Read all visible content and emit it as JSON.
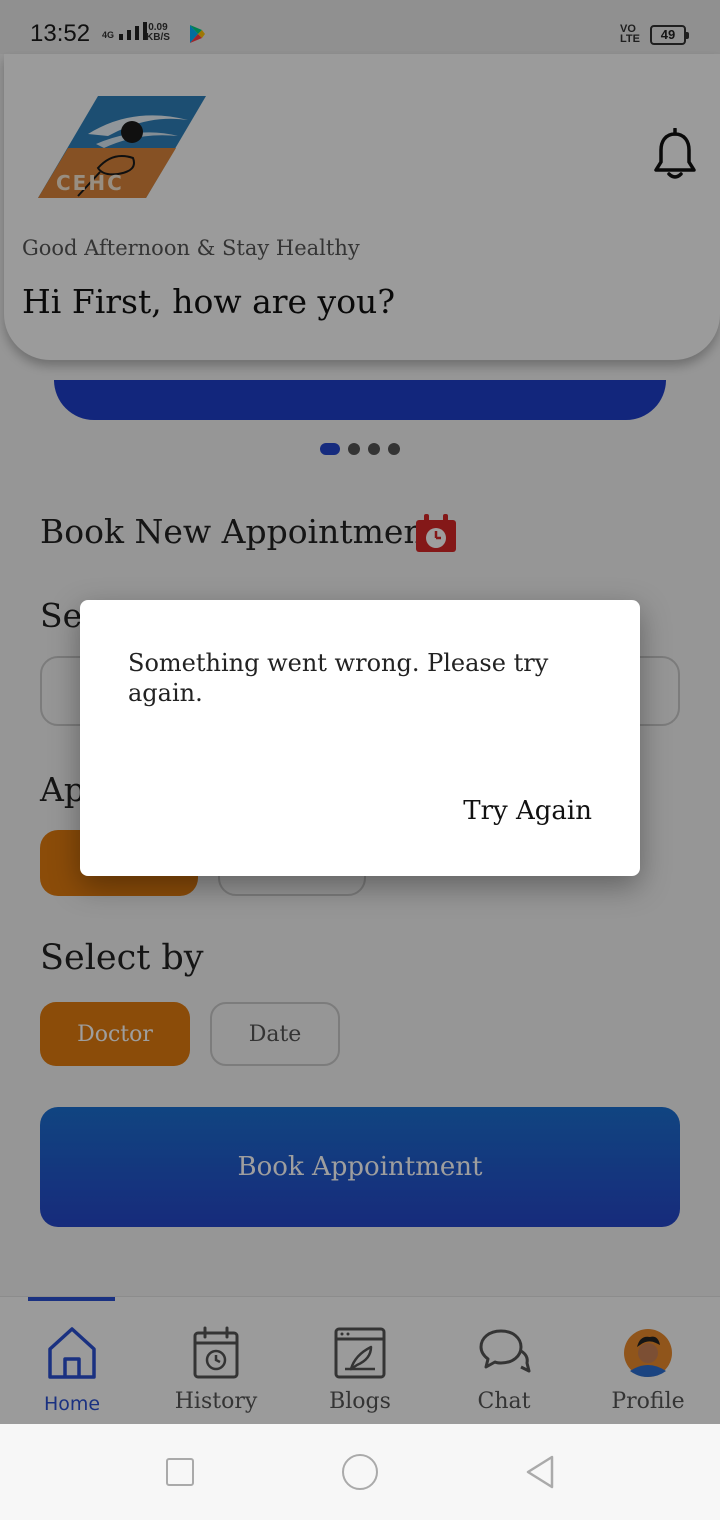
{
  "status_bar": {
    "time": "13:52",
    "network": "4G",
    "speed_value": "0.09",
    "speed_unit": "KB/S",
    "volte": "VO LTE",
    "battery": "49"
  },
  "header": {
    "logo_text": "CEHC",
    "greeting_sub": "Good Afternoon & Stay Healthy",
    "greeting_main": "Hi First, how are you?"
  },
  "carousel": {
    "pages": 4,
    "active_index": 0
  },
  "booking": {
    "title": "Book New Appointment",
    "partial_label_1": "Se",
    "partial_label_2": "Ap",
    "select_by_label": "Select by",
    "options": {
      "doctor": "Doctor",
      "date": "Date"
    },
    "selected": "Doctor",
    "book_button": "Book Appointment"
  },
  "bottom_nav": {
    "items": [
      {
        "label": "Home",
        "icon": "home-icon",
        "active": true
      },
      {
        "label": "History",
        "icon": "history-icon",
        "active": false
      },
      {
        "label": "Blogs",
        "icon": "blogs-icon",
        "active": false
      },
      {
        "label": "Chat",
        "icon": "chat-icon",
        "active": false
      },
      {
        "label": "Profile",
        "icon": "profile-avatar-icon",
        "active": false
      }
    ]
  },
  "dialog": {
    "message": "Something went wrong. Please try again.",
    "button": "Try Again"
  },
  "colors": {
    "accent_blue": "#2446cc",
    "accent_orange": "#e07b10",
    "overlay": "rgba(0,0,0,0.38)"
  }
}
